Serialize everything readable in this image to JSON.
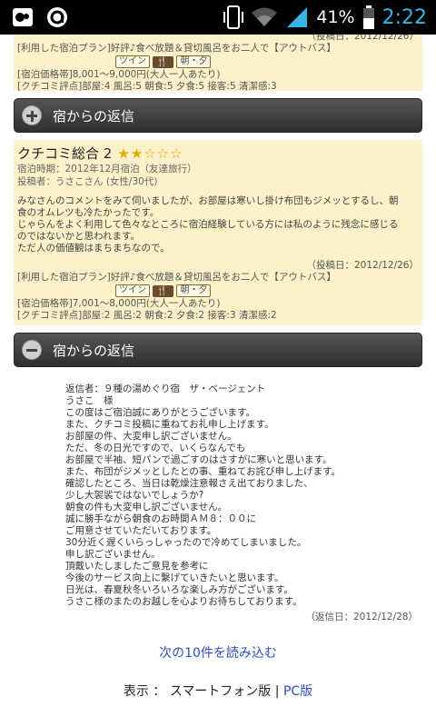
{
  "status_bar": {
    "battery_pct": "41%",
    "clock": "2:22"
  },
  "review1": {
    "posted": "（投稿日：2012/12/26）",
    "plan": "[利用した宿泊プラン]好評♪食べ放題＆貸切風呂をお二人で【アウトバス】",
    "tag_room": "ツイン",
    "tag_meal": "朝・夕",
    "price": "[宿泊価格帯]8,001～9,000円(大人一人あたり)",
    "scores": "[クチコミ評点]部屋:4 風呂:5 朝食:5 夕食:5 接客:5 清潔感:3"
  },
  "reply_bar_1": {
    "title": "宿からの返信"
  },
  "review2": {
    "title": "クチコミ総合 2",
    "stars_on": "★★",
    "stars_off": "☆☆☆",
    "stay": "宿泊時期：2012年12月宿泊（友達旅行）",
    "poster": "投稿者：うさこさん (女性/30代)",
    "body": [
      "みなさんのコメントをみて伺いましたが、お部屋は寒いし掛け布団もジメッとするし、朝",
      "食のオムレツも冷たかったです。",
      "じゃらんをよく利用して色々なところに宿泊経験している方には私のように残念に感じる",
      "のではないかと思われます。",
      "ただ人の価値観はまちまちなので。"
    ],
    "posted": "（投稿日：2012/12/26）",
    "plan": "[利用した宿泊プラン]好評♪食べ放題＆貸切風呂をお二人で【アウトバス】",
    "tag_room": "ツイン",
    "tag_meal": "朝・夕",
    "price": "[宿泊価格帯]7,001～8,000円(大人一人あたり)",
    "scores": "[クチコミ評点]部屋:2 風呂:2 朝食:2 夕食:2 接客:3 清潔感:2"
  },
  "reply_bar_2": {
    "title": "宿からの返信"
  },
  "reply": {
    "lines": [
      "返信者：９種の湯めぐり宿　ザ・ベージェント",
      "うさこ　様",
      "この度はご宿泊誠にありがとうございます。",
      "また、クチコミ投稿に重ねてお礼申し上げます。",
      "お部屋の件、大変申し訳ございません。",
      "ただ、冬の日光ですので、いくらなんでも",
      "お部屋で半袖、短パンで過ごすのはさすがに寒いと思います。",
      "また、布団がジメッとしたとの事、重ねてお詫び申し上げます。",
      "確認したところ、当日は乾燥注意報さえ出ておりました、",
      "少し大袈裟ではないでしょうか?",
      "朝食の件も大変申し訳ございません。",
      "誠に勝手ながら朝食のお時間ＡＭ８：００に",
      "ご用意させていただいております。",
      "30分近く遅くいらっしゃったので冷めてしまいました。",
      "申し訳ございません。",
      "頂戴いたしましたご意見を参考に",
      "今後のサービス向上に繋げていきたいと思います。",
      "日光は、春夏秋冬いろいろな楽しみ方がございます。",
      "うさこ様のまたのお越しを心よりお待ちしております。"
    ],
    "date": "（返信日：2012/12/28）"
  },
  "load_more": "次の10件を読み込む",
  "footer": {
    "prefix": "表示 ： スマートフォン版 | ",
    "pc": "PC版"
  },
  "colors": {
    "review_bg": "#fdf1c9",
    "link": "#2a4fbf",
    "clock": "#33b5e5"
  }
}
